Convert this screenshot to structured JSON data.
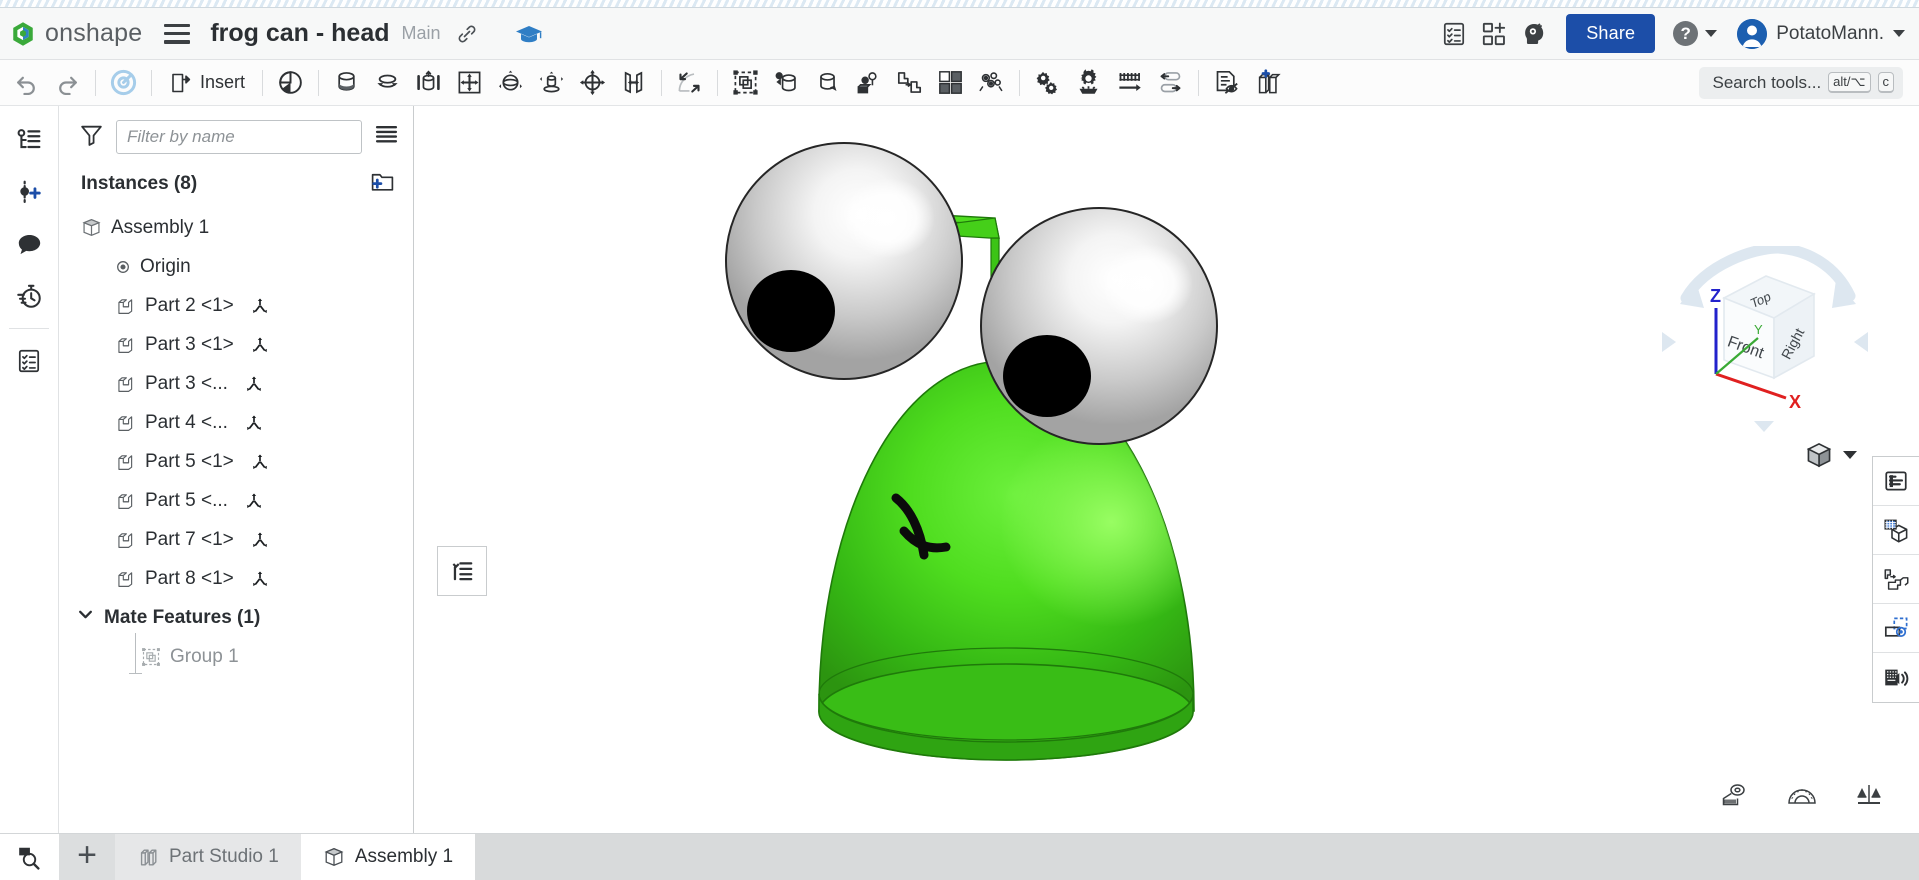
{
  "header": {
    "brand": "onshape",
    "brand_icon": "onshape-logo-icon",
    "menu_icon": "hamburger-menu-icon",
    "doc_title": "frog can - head",
    "branch": "Main",
    "link_icon": "link-icon",
    "learning_icon": "graduation-cap-icon",
    "icons": [
      {
        "name": "task-list-icon",
        "label": "Task list"
      },
      {
        "name": "app-grid-add-icon",
        "label": "Add app"
      },
      {
        "name": "ai-advisor-icon",
        "label": "AI advisor"
      }
    ],
    "share_label": "Share",
    "help_icon": "question-mark-icon",
    "user_name": "PotatoMann.",
    "avatar_icon": "user-avatar-icon",
    "accent_blue": "#1c4ea8"
  },
  "toolbar": {
    "items": [
      {
        "name": "undo-button",
        "icon": "undo-arrow-icon",
        "label": ""
      },
      {
        "name": "redo-button",
        "icon": "redo-arrow-icon",
        "label": ""
      },
      {
        "sep": true
      },
      {
        "name": "assembly-rebuild-button",
        "icon": "assembly-rotate-icon",
        "label": ""
      },
      {
        "sep": true
      },
      {
        "name": "insert-button",
        "icon": "insert-part-icon",
        "label": "Insert"
      },
      {
        "sep": true
      },
      {
        "name": "mate-button",
        "icon": "fastened-mate-icon",
        "label": ""
      },
      {
        "sep": true
      },
      {
        "name": "revolute-mate-button",
        "icon": "revolute-mate-icon",
        "label": ""
      },
      {
        "name": "slider-mate-button",
        "icon": "slider-mate-icon",
        "label": ""
      },
      {
        "name": "cylindrical-mate-button",
        "icon": "cylindrical-mate-icon",
        "label": ""
      },
      {
        "name": "planar-mate-button",
        "icon": "planar-mate-icon",
        "label": ""
      },
      {
        "name": "ball-mate-button",
        "icon": "ball-mate-icon",
        "label": ""
      },
      {
        "name": "pin-slot-mate-button",
        "icon": "pin-slot-mate-icon",
        "label": ""
      },
      {
        "name": "parallel-mate-button",
        "icon": "parallel-mate-icon",
        "label": ""
      },
      {
        "name": "tangent-mate-button",
        "icon": "tangent-mate-icon",
        "label": ""
      },
      {
        "sep": true
      },
      {
        "name": "mate-connector-button",
        "icon": "mate-connector-icon",
        "label": ""
      },
      {
        "sep": true
      },
      {
        "name": "group-button",
        "icon": "group-icon",
        "label": ""
      },
      {
        "name": "relation-button",
        "icon": "gear-relation-icon",
        "label": ""
      },
      {
        "name": "replicate-button",
        "icon": "replicate-icon",
        "label": ""
      },
      {
        "name": "assembly-pattern-button",
        "icon": "assembly-pattern-icon",
        "label": ""
      },
      {
        "name": "transform-button",
        "icon": "transform-copy-icon",
        "label": ""
      },
      {
        "name": "explode-button",
        "icon": "explode-view-icon",
        "label": ""
      },
      {
        "name": "bom-explode-button",
        "icon": "exploded-parts-icon",
        "label": ""
      },
      {
        "sep": true
      },
      {
        "name": "gear-relation-tool-button",
        "icon": "gears-icon",
        "label": ""
      },
      {
        "name": "configure-button",
        "icon": "gear-settings-icon",
        "label": ""
      },
      {
        "name": "rack-pinion-button",
        "icon": "rack-pinion-icon",
        "label": ""
      },
      {
        "name": "linear-relation-button",
        "icon": "linear-relation-icon",
        "label": ""
      },
      {
        "sep": true
      },
      {
        "name": "hide-show-button",
        "icon": "hide-document-icon",
        "label": ""
      },
      {
        "name": "insert-bom-button",
        "icon": "add-bom-icon",
        "label": ""
      }
    ],
    "search": {
      "label": "Search tools...",
      "shortcut_primary": "alt/⌥",
      "shortcut_secondary": "c"
    }
  },
  "rail": {
    "items": [
      {
        "name": "rail-item-assembly-tree",
        "icon": "feature-tree-icon"
      },
      {
        "name": "rail-item-add-mate-connector",
        "icon": "add-mate-connector-icon"
      },
      {
        "name": "rail-item-comments",
        "icon": "comment-bubble-icon"
      },
      {
        "name": "rail-item-history",
        "icon": "history-clock-icon"
      },
      {
        "name": "rail-item-tasks",
        "icon": "task-checklist-icon"
      }
    ],
    "bottom_icon": "search-magnifier-icon"
  },
  "tree": {
    "filter_placeholder": "Filter by name",
    "filter_value": "",
    "funnel_icon": "filter-funnel-icon",
    "list_icon": "list-view-icon",
    "instances_label": "Instances (8)",
    "new_folder_icon": "new-folder-icon",
    "root": {
      "label": "Assembly 1",
      "icon": "assembly-cube-icon"
    },
    "origin": {
      "label": "Origin",
      "icon": "origin-point-icon"
    },
    "parts": [
      {
        "label": "Part 2 <1>",
        "icon": "part-icon",
        "mate_icon": "mate-connector-icon"
      },
      {
        "label": "Part 3 <1>",
        "icon": "part-icon",
        "mate_icon": "mate-connector-icon"
      },
      {
        "label": "Part 3 <...",
        "icon": "part-icon",
        "mate_icon": "mate-connector-icon"
      },
      {
        "label": "Part 4 <...",
        "icon": "part-icon",
        "mate_icon": "mate-connector-icon"
      },
      {
        "label": "Part 5 <1>",
        "icon": "part-icon",
        "mate_icon": "mate-connector-icon"
      },
      {
        "label": "Part 5 <...",
        "icon": "part-icon",
        "mate_icon": "mate-connector-icon"
      },
      {
        "label": "Part 7 <1>",
        "icon": "part-icon",
        "mate_icon": "mate-connector-icon"
      },
      {
        "label": "Part 8 <1>",
        "icon": "part-icon",
        "mate_icon": "mate-connector-icon"
      }
    ],
    "mate_features": {
      "label": "Mate Features (1)",
      "collapse_icon": "chevron-down-icon",
      "items": [
        {
          "label": "Group 1",
          "icon": "group-mate-icon"
        }
      ]
    }
  },
  "viewport": {
    "mini_panel_icon": "collapse-list-icon",
    "viewcube": {
      "faces": {
        "top": "Top",
        "front": "Front",
        "right": "Right"
      },
      "axes": {
        "x": "X",
        "y": "Y",
        "z": "Z"
      },
      "axis_colors": {
        "x": "#e02020",
        "y": "#3aaa35",
        "z": "#2222cc"
      }
    },
    "display_mode": {
      "icon": "shaded-cube-icon",
      "caret": "chevron-down-icon"
    },
    "right_tools": [
      {
        "name": "display-states-button",
        "icon": "display-states-icon"
      },
      {
        "name": "section-view-button",
        "icon": "section-view-icon"
      },
      {
        "name": "exploded-view-button",
        "icon": "explode-transform-icon"
      },
      {
        "name": "render-button",
        "icon": "render-studio-icon"
      },
      {
        "name": "keyboard-shortcuts-button",
        "icon": "keyboard-sound-icon"
      }
    ],
    "measure_tools": [
      {
        "name": "measure-tape-button",
        "icon": "measuring-tape-icon"
      },
      {
        "name": "protractor-button",
        "icon": "protractor-icon"
      },
      {
        "name": "mass-properties-button",
        "icon": "scale-balance-icon"
      }
    ],
    "model": {
      "name": "frog-head-assembly",
      "body_color": "#3ec81e",
      "eye_color": "#e3e3e3",
      "pupil_color": "#000000"
    }
  },
  "bottom": {
    "search_icon": "document-search-icon",
    "add_tab_icon": "plus-icon",
    "tabs": [
      {
        "label": "Part Studio 1",
        "icon": "part-studio-icon",
        "active": false
      },
      {
        "label": "Assembly 1",
        "icon": "assembly-cube-icon",
        "active": true
      }
    ]
  }
}
